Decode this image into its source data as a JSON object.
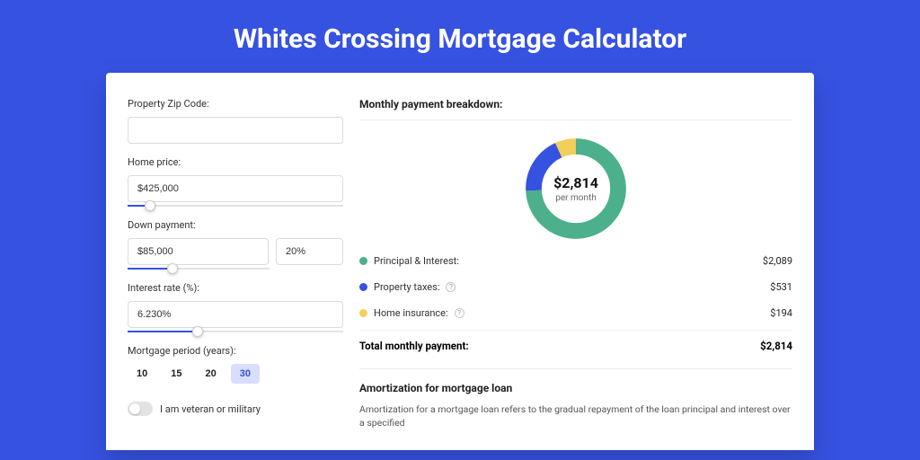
{
  "title": "Whites Crossing Mortgage Calculator",
  "form": {
    "zip_label": "Property Zip Code:",
    "zip_value": "",
    "home_price_label": "Home price:",
    "home_price_value": "$425,000",
    "down_payment_label": "Down payment:",
    "down_payment_value": "$85,000",
    "down_payment_pct": "20%",
    "interest_label": "Interest rate (%):",
    "interest_value": "6.230%",
    "period_label": "Mortgage period (years):",
    "periods": [
      "10",
      "15",
      "20",
      "30"
    ],
    "period_selected": "30",
    "veteran_label": "I am veteran or military",
    "veteran_on": false
  },
  "breakdown": {
    "title": "Monthly payment breakdown:",
    "donut_amount": "$2,814",
    "donut_sub": "per month",
    "items": [
      {
        "label": "Principal & Interest:",
        "value": "$2,089",
        "color": "g",
        "info": false
      },
      {
        "label": "Property taxes:",
        "value": "$531",
        "color": "b",
        "info": true
      },
      {
        "label": "Home insurance:",
        "value": "$194",
        "color": "y",
        "info": true
      }
    ],
    "total_label": "Total monthly payment:",
    "total_value": "$2,814"
  },
  "amortization": {
    "title": "Amortization for mortgage loan",
    "body": "Amortization for a mortgage loan refers to the gradual repayment of the loan principal and interest over a specified"
  },
  "chart_data": {
    "type": "pie",
    "title": "Monthly payment breakdown",
    "series": [
      {
        "name": "Principal & Interest",
        "value": 2089,
        "color": "#4BB08B"
      },
      {
        "name": "Property taxes",
        "value": 531,
        "color": "#3652E1"
      },
      {
        "name": "Home insurance",
        "value": 194,
        "color": "#F2CE5B"
      }
    ],
    "total": 2814,
    "center_label": "$2,814 per month"
  }
}
